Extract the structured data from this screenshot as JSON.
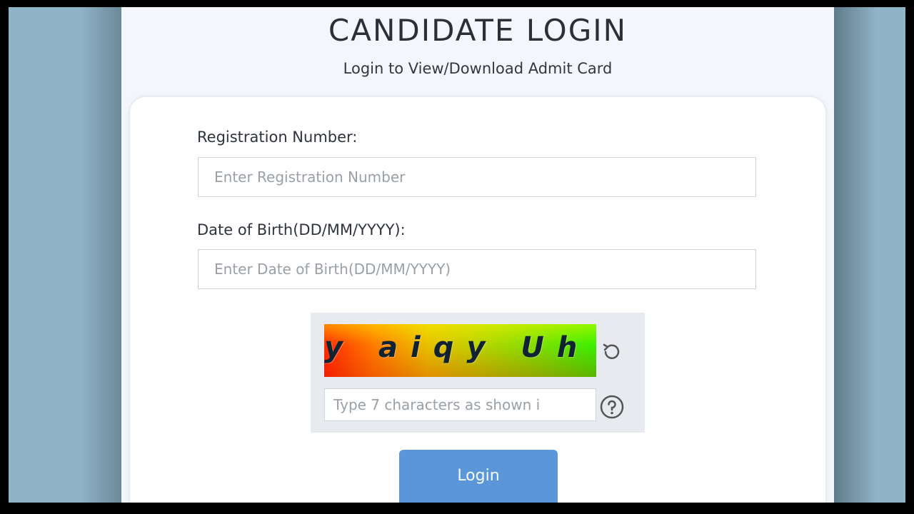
{
  "header": {
    "title": "CANDIDATE LOGIN",
    "subtitle": "Login to View/Download Admit Card"
  },
  "form": {
    "registration": {
      "label": "Registration Number:",
      "placeholder": "Enter Registration Number",
      "value": ""
    },
    "dob": {
      "label": "Date of Birth(DD/MM/YYYY):",
      "placeholder": "Enter Date of Birth(DD/MM/YYYY)",
      "value": ""
    },
    "captcha": {
      "image_text": "y aiqy Uh",
      "input_placeholder": "Type 7 characters as shown i",
      "refresh_icon": "refresh-icon",
      "help_icon": "help-icon"
    },
    "login_label": "Login"
  },
  "colors": {
    "background": "#8fb3c7",
    "panel": "#f3f6fb",
    "card": "#ffffff",
    "button": "#5b97d8",
    "captcha_box": "#e7eaee"
  }
}
